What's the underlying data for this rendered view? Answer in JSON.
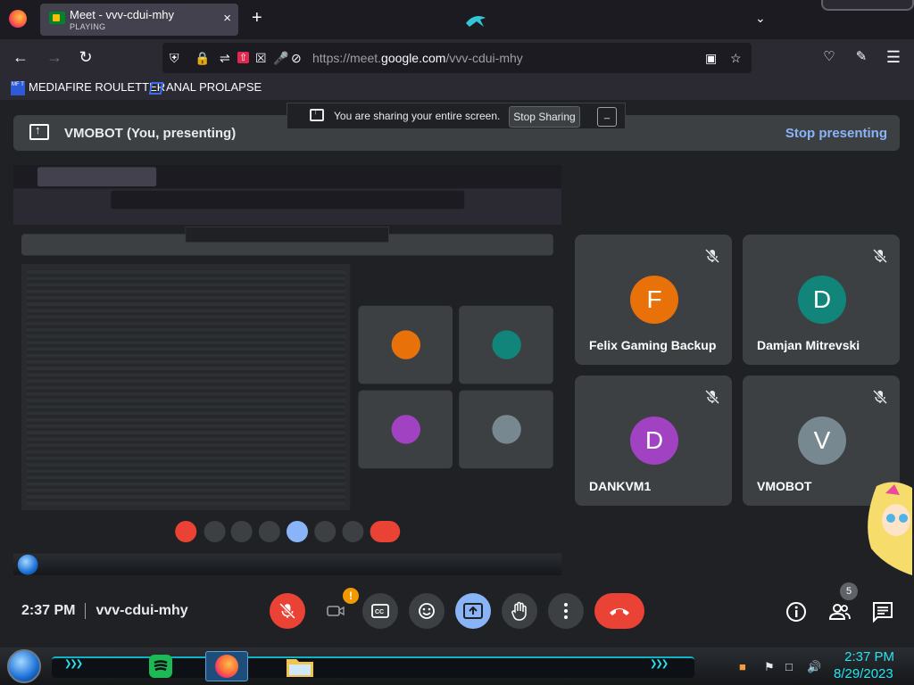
{
  "browser": {
    "tab": {
      "title": "Meet - vvv-cdui-mhy",
      "subtitle": "PLAYING",
      "close": "×"
    },
    "new_tab": "+",
    "url_prefix": "https://meet.",
    "url_domain": "google.com",
    "url_path": "/vvv-cdui-mhy",
    "bookmarks": [
      "MEDIAFIRE ROULETTER",
      "ANAL PROLAPSE"
    ],
    "bookmark_icon_text": "MF T"
  },
  "share_bar": {
    "text": "You are sharing your entire screen.",
    "stop_label": "Stop Sharing",
    "minimize": "_"
  },
  "banner": {
    "label": "VMOBOT (You, presenting)",
    "stop_label": "Stop presenting"
  },
  "participants": [
    {
      "initial": "F",
      "name": "Felix Gaming Backup",
      "color": "#e8710a"
    },
    {
      "initial": "D",
      "name": "Damjan Mitrevski",
      "color": "#12857a"
    },
    {
      "initial": "D",
      "name": "DANKVM1",
      "color": "#a142c3"
    },
    {
      "initial": "V",
      "name": "VMOBOT",
      "color": "#778891"
    }
  ],
  "meeting": {
    "time": "2:37 PM",
    "code": "vvv-cdui-mhy",
    "camera_badge": "!",
    "people_count": "5"
  },
  "controls": [
    "mic-off",
    "camera-off",
    "captions",
    "emoji",
    "present",
    "raise-hand",
    "more",
    "end-call"
  ],
  "right_controls": [
    "info",
    "people",
    "chat"
  ],
  "taskbar": {
    "time": "2:37 PM",
    "date": "8/29/2023",
    "chevrons": "❯❯❯"
  },
  "colors": {
    "accent": "#8ab4f8",
    "danger": "#ea4335",
    "surface": "#3c4043",
    "background": "#202124",
    "taskbar_text": "#23e6f0"
  }
}
